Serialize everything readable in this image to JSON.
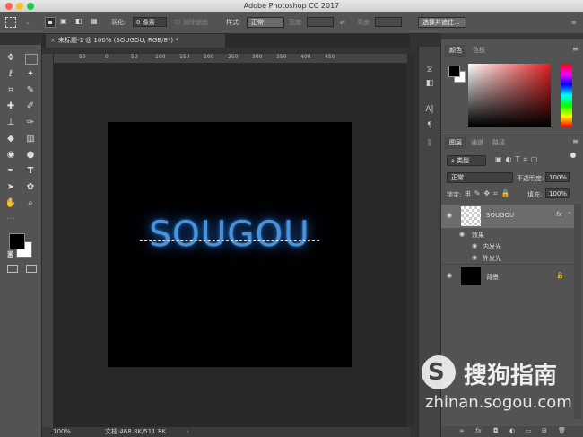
{
  "window": {
    "title": "Adobe Photoshop CC 2017"
  },
  "options_bar": {
    "feather_label": "羽化:",
    "feather_value": "0 像素",
    "antialias_label": "消除锯齿",
    "style_label": "样式:",
    "style_value": "正常",
    "width_label": "宽度:",
    "height_label": "高度:",
    "select_mask_button": "选择并遮住..."
  },
  "document": {
    "tab_title": "未标题-1 @ 100% (SOUGOU, RGB/8*) *",
    "canvas_text": "SOUGOU",
    "zoom": "100%",
    "doc_info": "文档:468.8K/511.8K"
  },
  "ruler": {
    "top_marks": [
      "50",
      "0",
      "50",
      "100",
      "150",
      "200",
      "250",
      "300",
      "350",
      "400",
      "450"
    ]
  },
  "panels": {
    "color_tabs": [
      "颜色",
      "色板"
    ],
    "layers_tabs": [
      "图层",
      "通道",
      "路径"
    ],
    "filter_kind": "类型",
    "blend_mode": "正常",
    "opacity_label": "不透明度:",
    "opacity_value": "100%",
    "lock_label": "锁定:",
    "fill_label": "填充:",
    "fill_value": "100%",
    "layers": [
      {
        "name": "SOUGOU",
        "fx": "fx"
      },
      {
        "name": "背景"
      }
    ],
    "effects_label": "效果",
    "effects": [
      "内发光",
      "外发光"
    ],
    "bottom_icons": [
      "∞",
      "fx"
    ]
  },
  "watermark": {
    "brand": "搜狗指南",
    "url": "zhinan.sogou.com"
  },
  "colors": {
    "glow": "#4a93d8",
    "panel": "#535353"
  }
}
